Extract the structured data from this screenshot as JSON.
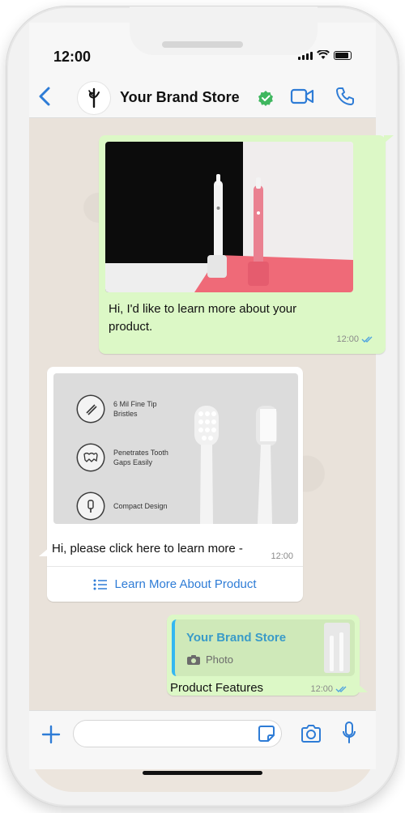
{
  "status_bar": {
    "time": "12:00"
  },
  "header": {
    "store_name": "Your Brand Store"
  },
  "messages": [
    {
      "direction": "outgoing",
      "text": "Hi, I'd like to learn more about your product.",
      "time": "12:00"
    },
    {
      "direction": "incoming",
      "features": [
        {
          "label": "6 Mil Fine Tip Bristles"
        },
        {
          "label": "Penetrates Tooth Gaps Easily"
        },
        {
          "label": "Compact Design"
        }
      ],
      "text": "Hi, please click here to learn more -",
      "time": "12:00",
      "cta_label": "Learn More About Product"
    },
    {
      "direction": "outgoing",
      "quote_title": "Your Brand Store",
      "quote_type": "Photo",
      "text": "Product Features",
      "time": "12:00"
    }
  ],
  "colors": {
    "accent": "#2e7cd6",
    "outgoing_bubble": "#dcf8c6",
    "read_tick": "#4fa3e0",
    "verified": "#3fb75f"
  }
}
